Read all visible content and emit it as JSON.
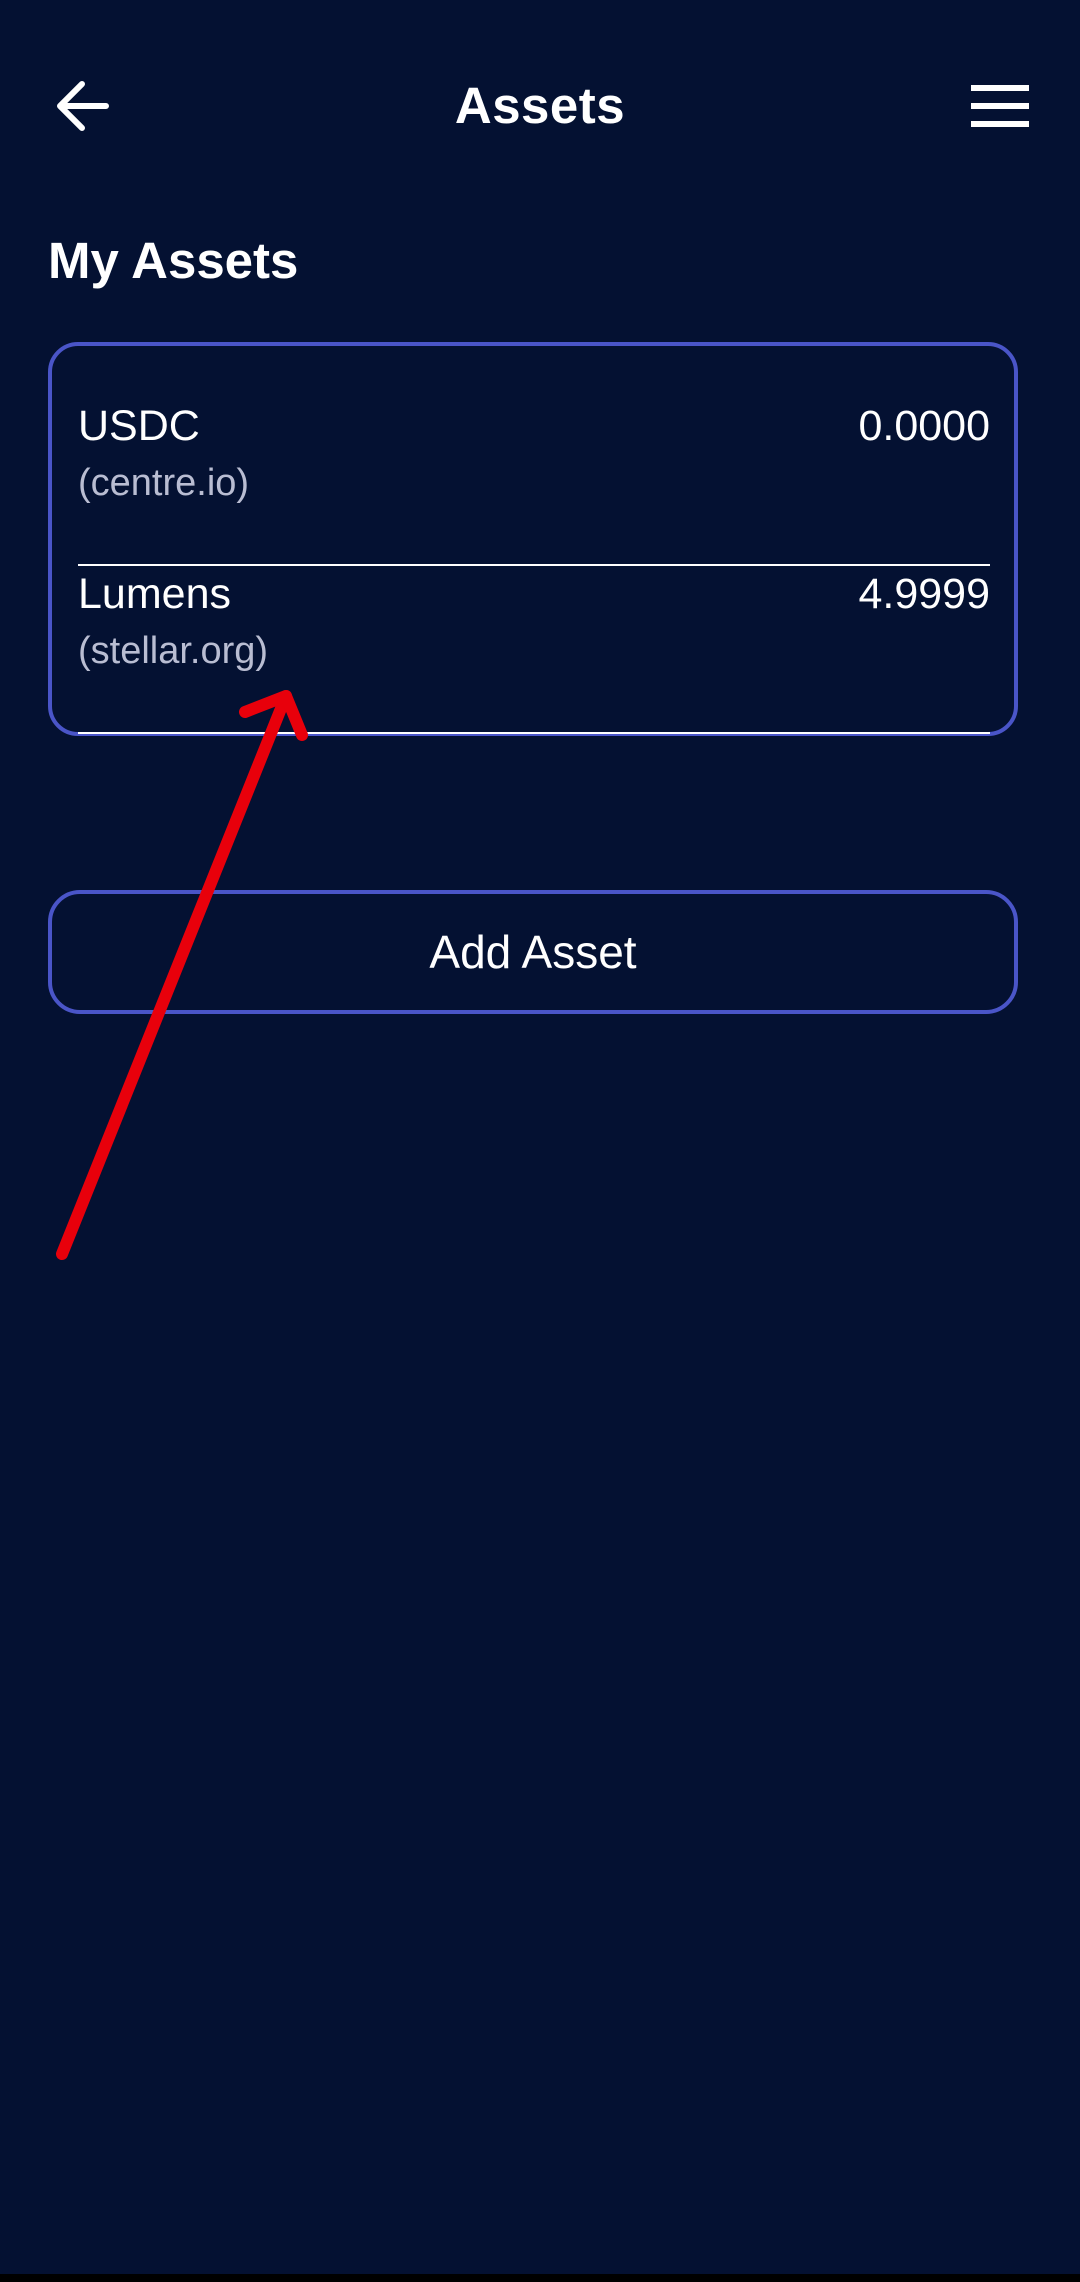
{
  "header": {
    "title": "Assets",
    "back_icon": "arrow-left-icon",
    "menu_icon": "hamburger-menu-icon"
  },
  "section": {
    "title": "My Assets"
  },
  "assets": [
    {
      "name": "USDC",
      "domain": "(centre.io)",
      "balance": "0.0000"
    },
    {
      "name": "Lumens",
      "domain": "(stellar.org)",
      "balance": "4.9999"
    }
  ],
  "actions": {
    "add_asset_label": "Add Asset"
  },
  "colors": {
    "background": "#041132",
    "accent_border": "#4a55c8",
    "text_primary": "#ffffff",
    "text_secondary": "#b9bdd2",
    "annotation_arrow": "#e8000b"
  }
}
